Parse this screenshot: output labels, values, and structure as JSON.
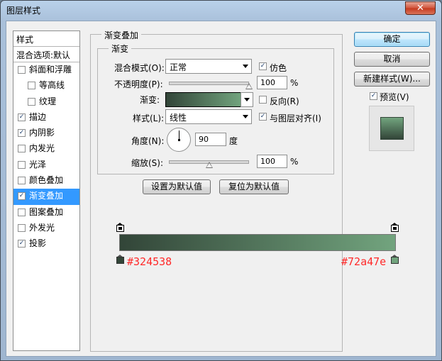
{
  "window": {
    "title": "图层样式",
    "close_glyph": "✕"
  },
  "sidebar": {
    "header": "样式",
    "blend_options": "混合选项:默认",
    "items": [
      {
        "label": "斜面和浮雕",
        "checked": false
      },
      {
        "label": "等高线",
        "checked": false,
        "sub": true
      },
      {
        "label": "纹理",
        "checked": false,
        "sub": true
      },
      {
        "label": "描边",
        "checked": true
      },
      {
        "label": "内阴影",
        "checked": true
      },
      {
        "label": "内发光",
        "checked": false
      },
      {
        "label": "光泽",
        "checked": false
      },
      {
        "label": "颜色叠加",
        "checked": false
      },
      {
        "label": "渐变叠加",
        "checked": true,
        "active": true
      },
      {
        "label": "图案叠加",
        "checked": false
      },
      {
        "label": "外发光",
        "checked": false
      },
      {
        "label": "投影",
        "checked": true
      }
    ]
  },
  "panel": {
    "title": "渐变叠加",
    "group_title": "渐变",
    "blend_mode_label": "混合模式(O):",
    "blend_mode_value": "正常",
    "dither_label": "仿色",
    "opacity_label": "不透明度(P):",
    "opacity_value": "100",
    "opacity_level": 100,
    "gradient_label": "渐变:",
    "reverse_label": "反向(R)",
    "style_label": "样式(L):",
    "style_value": "线性",
    "align_label": "与图层对齐(I)",
    "angle_label": "角度(N):",
    "angle_value": "90",
    "angle_unit": "度",
    "scale_label": "缩放(S):",
    "scale_value": "100",
    "scale_level": 100,
    "percent": "%",
    "set_default": "设置为默认值",
    "reset_default": "复位为默认值"
  },
  "buttons": {
    "ok": "确定",
    "cancel": "取消",
    "new_style": "新建样式(W)...",
    "preview": "预览(V)"
  },
  "gradient": {
    "start_color": "#324538",
    "end_color": "#72a47e",
    "start_label": "#324538",
    "end_label": "#72a47e"
  },
  "checks": {
    "dither": true,
    "reverse": false,
    "align": true,
    "preview": true
  },
  "icons": {
    "check": "✓"
  }
}
